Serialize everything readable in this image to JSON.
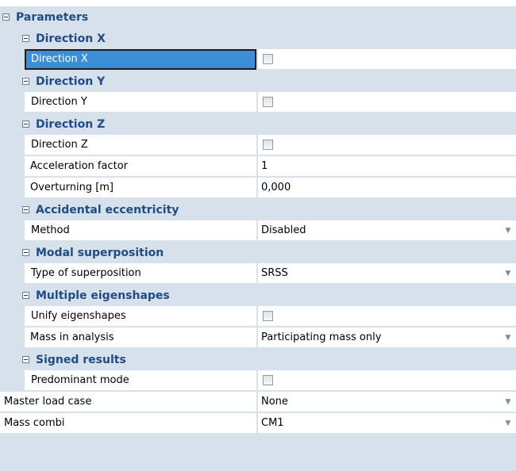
{
  "sections": {
    "parameters": "Parameters",
    "dirx": "Direction X",
    "diry": "Direction Y",
    "dirz": "Direction Z",
    "accidental": "Accidental eccentricity",
    "modal": "Modal superposition",
    "multiple": "Multiple eigenshapes",
    "signed": "Signed results"
  },
  "props": {
    "dirx": {
      "label": "Direction X",
      "checked": false
    },
    "diry": {
      "label": "Direction Y",
      "checked": false
    },
    "dirz": {
      "label": "Direction Z",
      "checked": false
    },
    "accel": {
      "label": "Acceleration factor",
      "value": "1"
    },
    "overturn": {
      "label": "Overturning [m]",
      "value": "0,000"
    },
    "method": {
      "label": "Method",
      "value": "Disabled"
    },
    "superpos": {
      "label": "Type of superposition",
      "value": "SRSS"
    },
    "unify": {
      "label": "Unify eigenshapes",
      "checked": false
    },
    "mass": {
      "label": "Mass in analysis",
      "value": "Participating mass only"
    },
    "predominant": {
      "label": "Predominant mode",
      "checked": false
    },
    "master": {
      "label": "Master load case",
      "value": "None"
    },
    "combi": {
      "label": "Mass combi",
      "value": "CM1"
    }
  },
  "icons": {
    "collapse": "minus-box-icon",
    "dropdown": "dropdown-arrow-icon",
    "checkbox": "checkbox-icon"
  }
}
